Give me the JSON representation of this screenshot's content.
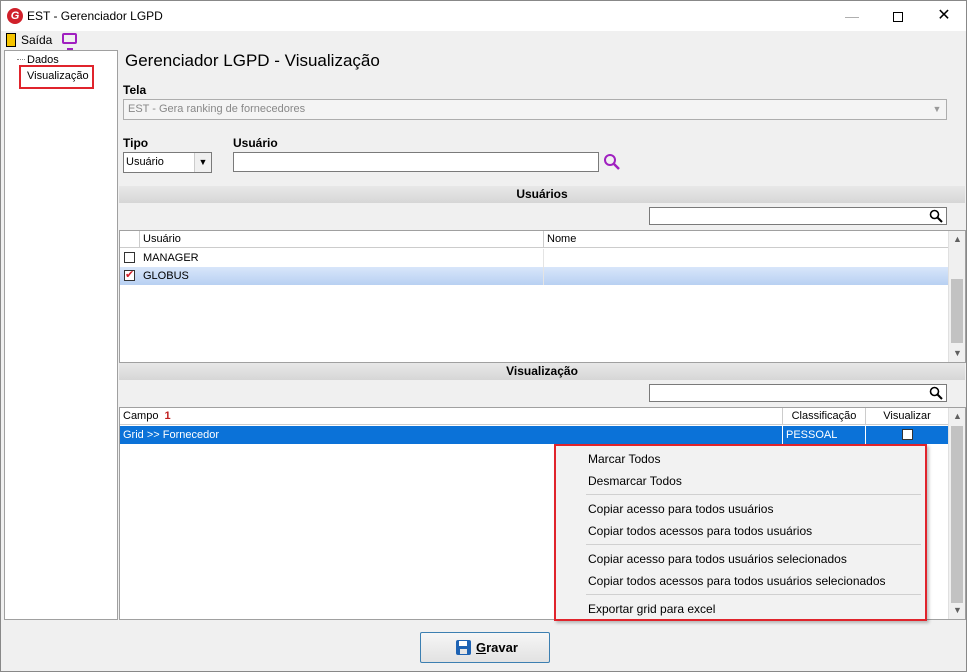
{
  "window": {
    "title": "EST - Gerenciador LGPD",
    "minimize": "—",
    "close": "✕"
  },
  "menu": {
    "exit_label": "Saída"
  },
  "tree": {
    "items": [
      "Dados",
      "Visualização"
    ]
  },
  "page": {
    "title": "Gerenciador LGPD - Visualização"
  },
  "form": {
    "tela_label": "Tela",
    "tela_value": "EST - Gera ranking de fornecedores",
    "tipo_label": "Tipo",
    "tipo_value": "Usuário",
    "usuario_label": "Usuário",
    "usuario_value": ""
  },
  "usuarios": {
    "section_title": "Usuários",
    "columns": [
      "Usuário",
      "Nome"
    ],
    "rows": [
      {
        "usuario": "MANAGER",
        "nome": "",
        "checked": false
      },
      {
        "usuario": "GLOBUS",
        "nome": "",
        "checked": true
      }
    ]
  },
  "visualizacao": {
    "section_title": "Visualização",
    "columns": [
      "Campo",
      "Classificação",
      "Visualizar"
    ],
    "sort_indicator": "1",
    "rows": [
      {
        "campo": "Grid >> Fornecedor",
        "classificacao": "PESSOAL",
        "visualizar": false
      }
    ]
  },
  "context_menu": {
    "items": [
      "Marcar Todos",
      "Desmarcar Todos",
      "Copiar acesso para todos usuários",
      "Copiar todos acessos para todos usuários",
      "Copiar acesso para todos usuários selecionados",
      "Copiar todos acessos para todos usuários selecionados",
      "Exportar grid para excel"
    ]
  },
  "footer": {
    "save_label_rest": "ravar",
    "save_label_first": "G"
  },
  "colors": {
    "accent_red": "#e0242c",
    "selection_blue": "#0b72d8",
    "search_purple": "#a020c0"
  },
  "icons": {
    "app": "logo-g-icon",
    "exit": "exit-door-icon",
    "monitor": "monitor-icon",
    "search": "search-icon",
    "save": "floppy-disk-icon"
  }
}
